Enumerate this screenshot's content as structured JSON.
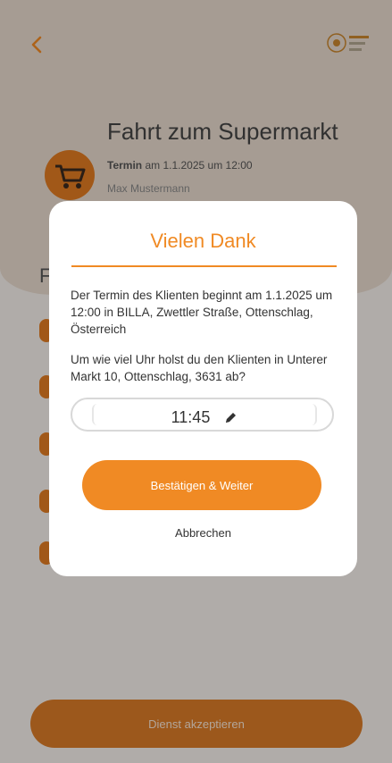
{
  "header": {
    "back_icon": "chevron-left-icon",
    "logo_icon": "logo-icon"
  },
  "event": {
    "title": "Fahrt zum Supermarkt",
    "termin_label": "Termin",
    "termin_text": "am 1.1.2025 um 12:00",
    "client_name": "Max Mustermann"
  },
  "background": {
    "partial_letter": "F"
  },
  "dialog": {
    "title": "Vielen Dank",
    "info_text": "Der Termin des Klienten beginnt am 1.1.2025 um 12:00 in BILLA, Zwettler Straße, Ottenschlag, Österreich",
    "question_text": "Um wie viel Uhr holst du den Klienten in Unterer Markt 10, Ottenschlag, 3631 ab?",
    "time_value": "11:45",
    "confirm_label": "Bestätigen & Weiter",
    "cancel_label": "Abbrechen"
  },
  "footer": {
    "accept_label": "Dienst akzeptieren"
  },
  "colors": {
    "accent": "#f08a24",
    "footer_button": "#d97a27"
  }
}
